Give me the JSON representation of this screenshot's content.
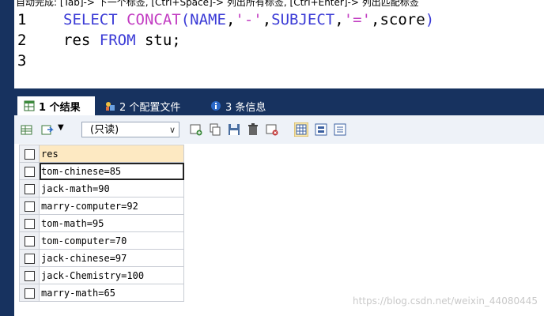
{
  "autocomplete_hint": "自动完成: [Tab]-> 下一个标签, [Ctrl+Space]-> 列出所有标签, [Ctrl+Enter]-> 列出匹配标签",
  "editor": {
    "lines": [
      {
        "num": "1",
        "tokens": [
          {
            "t": "SELECT ",
            "c": "kw"
          },
          {
            "t": "CONCAT",
            "c": "fn"
          },
          {
            "t": "(",
            "c": "paren"
          },
          {
            "t": "NAME",
            "c": "kw"
          },
          {
            "t": ",",
            "c": "plain"
          },
          {
            "t": "'-'",
            "c": "str"
          },
          {
            "t": ",",
            "c": "plain"
          },
          {
            "t": "SUBJECT",
            "c": "kw"
          },
          {
            "t": ",",
            "c": "plain"
          },
          {
            "t": "'='",
            "c": "str"
          },
          {
            "t": ",",
            "c": "plain"
          },
          {
            "t": "score",
            "c": "plain"
          },
          {
            "t": ")",
            "c": "paren"
          }
        ]
      },
      {
        "num": "2",
        "tokens": [
          {
            "t": "res ",
            "c": "plain"
          },
          {
            "t": "FROM",
            "c": "kw"
          },
          {
            "t": " stu;",
            "c": "plain"
          }
        ]
      },
      {
        "num": "3",
        "tokens": []
      }
    ]
  },
  "tabs": [
    {
      "label": "1 个结果",
      "icon": "result-grid-icon",
      "active": true
    },
    {
      "label": "2 个配置文件",
      "icon": "profile-icon",
      "active": false
    },
    {
      "label": "3 条信息",
      "icon": "info-icon",
      "active": false
    }
  ],
  "toolbar": {
    "mode_select_value": "(只读)"
  },
  "grid": {
    "header": "res",
    "rows": [
      "tom-chinese=85",
      "jack-math=90",
      "marry-computer=92",
      "tom-math=95",
      "tom-computer=70",
      "jack-chinese=97",
      "jack-Chemistry=100",
      "marry-math=65"
    ]
  },
  "watermark": "https://blog.csdn.net/weixin_44080445",
  "colors": {
    "dark_band": "#17325f",
    "keyword": "#3b3bd6",
    "function": "#c23cc2",
    "header_cell": "#fde9c2"
  }
}
